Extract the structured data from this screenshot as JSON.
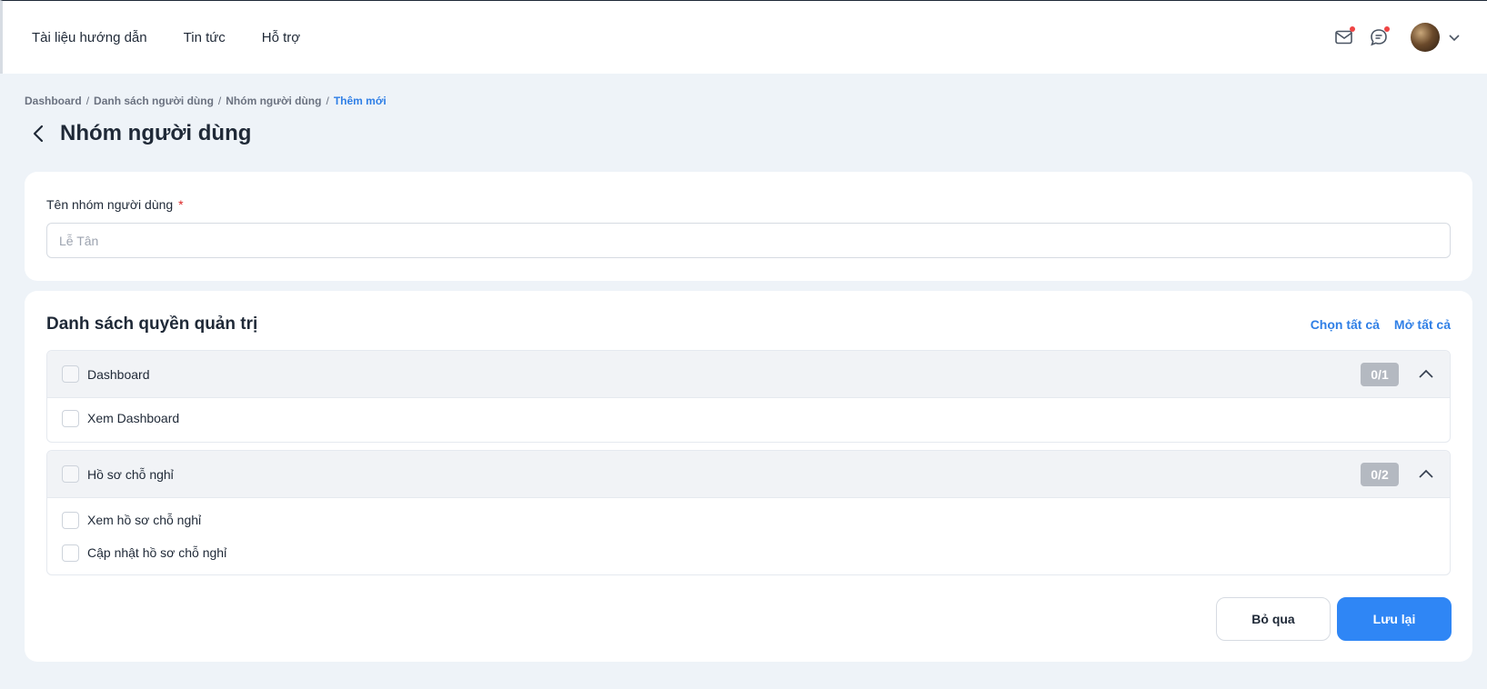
{
  "topnav": {
    "items": [
      "Tài liệu hướng dẫn",
      "Tin tức",
      "Hỗ trợ"
    ]
  },
  "header_icons": {
    "mail": "mail-icon",
    "chat": "chat-icon",
    "notification_color": "#ef4444"
  },
  "breadcrumb": {
    "items": [
      "Dashboard",
      "Danh sách người dùng",
      "Nhóm người dùng"
    ],
    "current": "Thêm mới",
    "separator": "/"
  },
  "page": {
    "title": "Nhóm người dùng"
  },
  "form": {
    "name_label": "Tên nhóm người dùng",
    "required_mark": "*",
    "name_value": "",
    "name_placeholder": "Lễ Tân"
  },
  "permissions": {
    "title": "Danh sách quyền quản trị",
    "select_all": "Chọn tất cả",
    "expand_all": "Mở tất cả",
    "groups": [
      {
        "name": "Dashboard",
        "count": "0/1",
        "items": [
          "Xem Dashboard"
        ]
      },
      {
        "name": "Hồ sơ chỗ nghỉ",
        "count": "0/2",
        "items": [
          "Xem hồ sơ chỗ nghỉ",
          "Cập nhật hồ sơ chỗ nghỉ"
        ]
      }
    ]
  },
  "actions": {
    "cancel": "Bỏ qua",
    "save": "Lưu lại"
  },
  "colors": {
    "accent": "#2f86f5",
    "link": "#2f7fe6",
    "background": "#eef3f8",
    "badge": "#b4b9c1"
  }
}
